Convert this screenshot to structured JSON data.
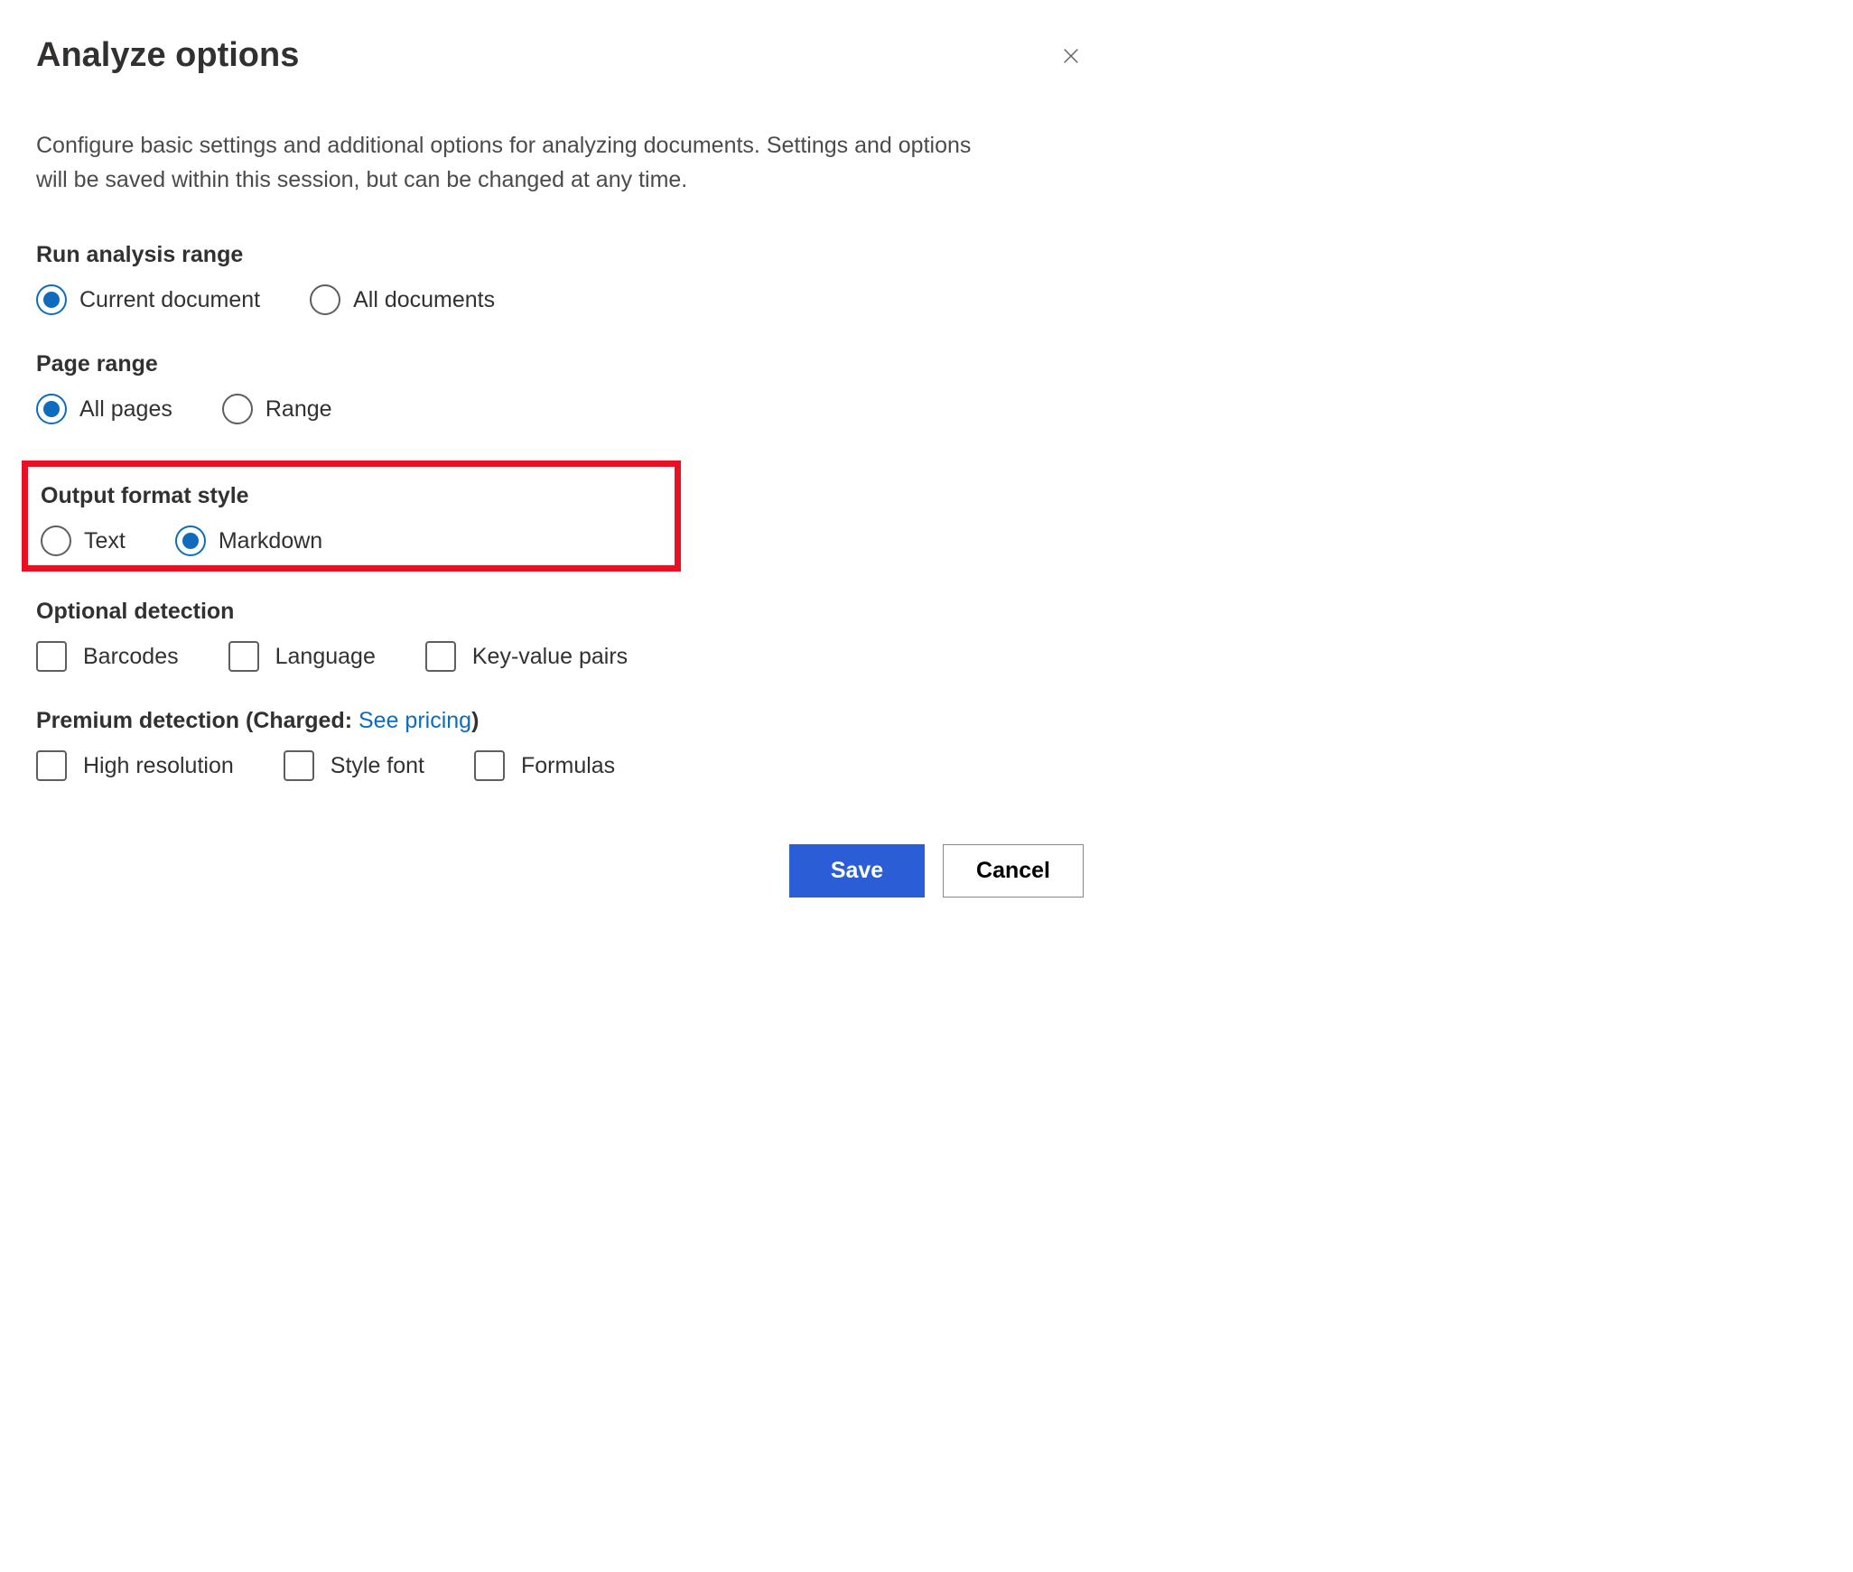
{
  "dialog": {
    "title": "Analyze options",
    "description": "Configure basic settings and additional options for analyzing documents. Settings and options will be saved within this session, but can be changed at any time."
  },
  "sections": {
    "analysis_range": {
      "title": "Run analysis range",
      "options": [
        {
          "label": "Current document",
          "selected": true
        },
        {
          "label": "All documents",
          "selected": false
        }
      ]
    },
    "page_range": {
      "title": "Page range",
      "options": [
        {
          "label": "All pages",
          "selected": true
        },
        {
          "label": "Range",
          "selected": false
        }
      ]
    },
    "output_format": {
      "title": "Output format style",
      "options": [
        {
          "label": "Text",
          "selected": false
        },
        {
          "label": "Markdown",
          "selected": true
        }
      ]
    },
    "optional_detection": {
      "title": "Optional detection",
      "options": [
        {
          "label": "Barcodes",
          "checked": false
        },
        {
          "label": "Language",
          "checked": false
        },
        {
          "label": "Key-value pairs",
          "checked": false
        }
      ]
    },
    "premium_detection": {
      "title_prefix": "Premium detection (Charged: ",
      "link_text": "See pricing",
      "title_suffix": ")",
      "options": [
        {
          "label": "High resolution",
          "checked": false
        },
        {
          "label": "Style font",
          "checked": false
        },
        {
          "label": "Formulas",
          "checked": false
        }
      ]
    }
  },
  "buttons": {
    "save": "Save",
    "cancel": "Cancel"
  }
}
